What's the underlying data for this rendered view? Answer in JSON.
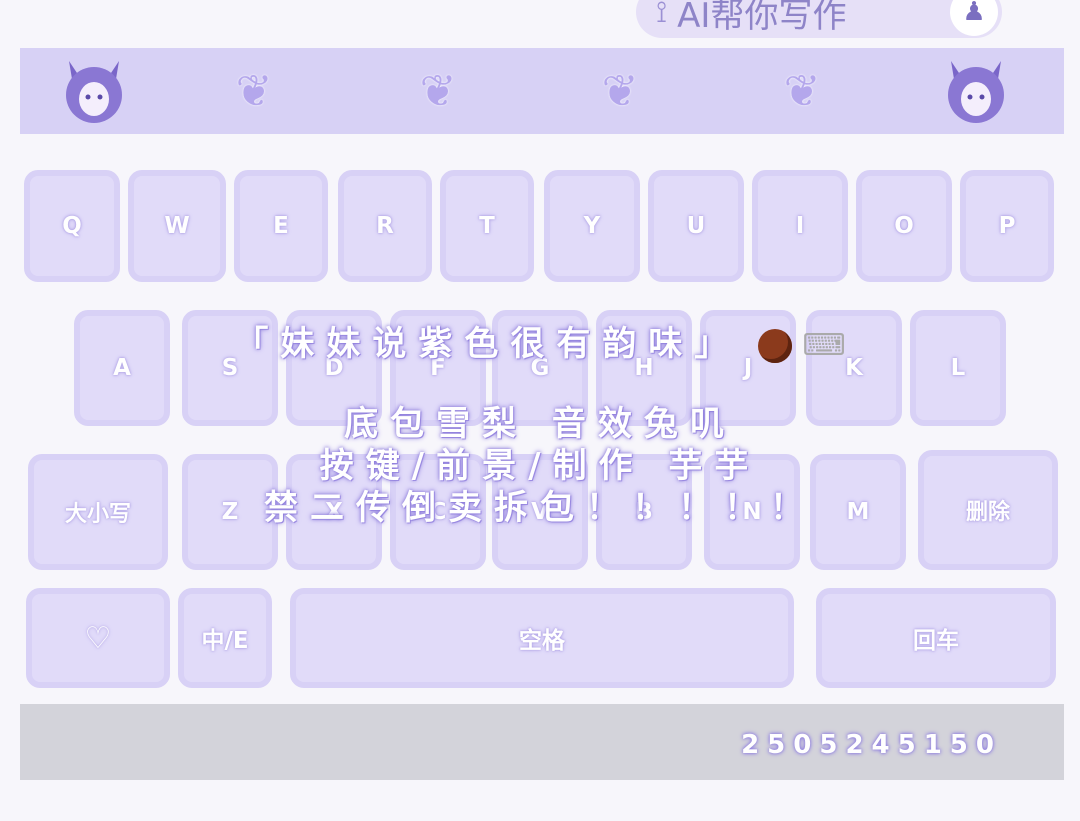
{
  "ai_button": {
    "icon": "brain-icon",
    "label": "AI帮你写作",
    "lock_icon": "user-lock-icon"
  },
  "toolbar": {
    "items": [
      {
        "name": "avatar-left",
        "icon": "catgirl-avatar-icon"
      },
      {
        "name": "heart-1",
        "icon": "winged-heart-icon"
      },
      {
        "name": "heart-2",
        "icon": "winged-heart-icon"
      },
      {
        "name": "heart-3",
        "icon": "winged-heart-icon"
      },
      {
        "name": "heart-4",
        "icon": "winged-heart-icon"
      },
      {
        "name": "avatar-right",
        "icon": "catgirl-avatar-icon"
      }
    ]
  },
  "keyboard": {
    "row1": [
      "Q",
      "W",
      "E",
      "R",
      "T",
      "Y",
      "U",
      "I",
      "O",
      "P"
    ],
    "row2": [
      "A",
      "S",
      "D",
      "F",
      "G",
      "H",
      "J",
      "K",
      "L"
    ],
    "row3": [
      "大小写",
      "Z",
      "X",
      "C",
      "V",
      "B",
      "N",
      "M",
      "删除"
    ],
    "row4": {
      "emoji_icon": "♡",
      "lang": "中/E",
      "space": "空格",
      "enter": "回车"
    }
  },
  "overlay": {
    "line1": "「妹妹说紫色很有韵味」",
    "line1_icons": [
      "chestnut-icon",
      "keyboard-icon"
    ],
    "line2": "底包雪梨  音效兔叽",
    "line3": "按键/前景/制作  芋芋",
    "line4": "禁二传倒卖拆包！！！！！"
  },
  "banner": {
    "code": "2505245150"
  },
  "colors": {
    "accent": "#8e84c8",
    "key_bg": "#e1dbf9",
    "toolbar_bg": "#d7d1f5",
    "banner_bg": "#d3d3da"
  }
}
